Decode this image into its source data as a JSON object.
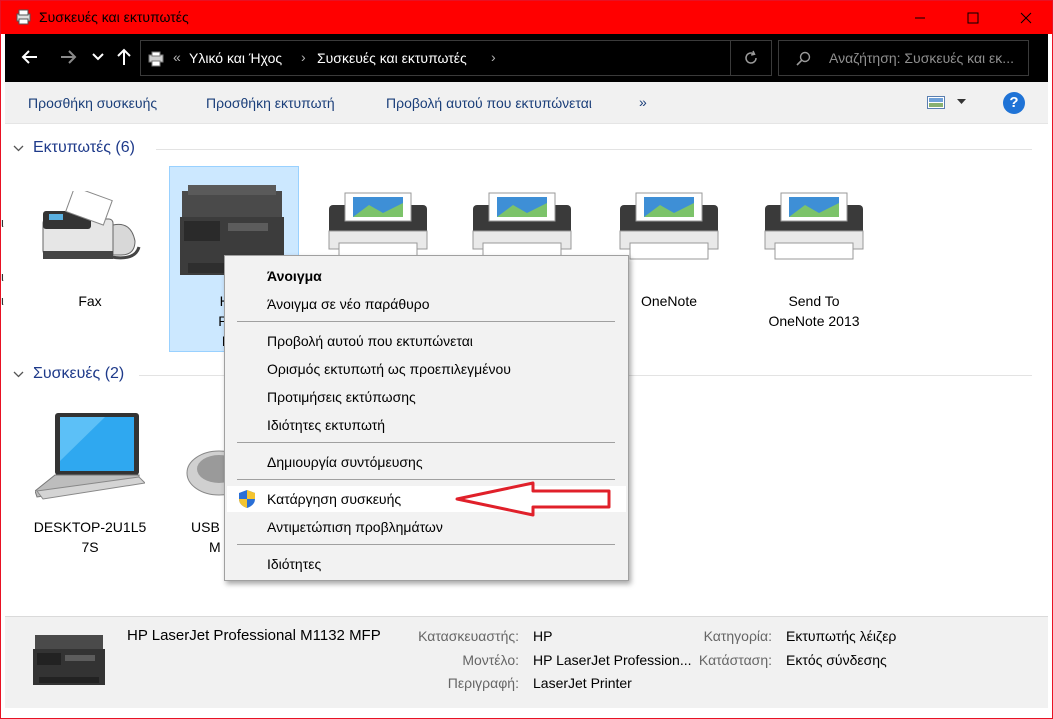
{
  "window": {
    "title": "Συσκευές και εκτυπωτές",
    "accent_color": "#ff0000"
  },
  "address_bar": {
    "overflow": "«",
    "breadcrumbs": [
      "Υλικό και Ήχος",
      "Συσκευές και εκτυπωτές"
    ],
    "search_placeholder": "Αναζήτηση: Συσκευές και εκ..."
  },
  "command_bar": {
    "items": [
      "Προσθήκη συσκευής",
      "Προσθήκη εκτυπωτή",
      "Προβολή αυτού που εκτυπώνεται"
    ],
    "more": "»",
    "help": "?"
  },
  "printers": {
    "header": "Εκτυπωτές (6)",
    "items": [
      {
        "label": "Fax",
        "icon": "fax-icon"
      },
      {
        "label": "HP L... Prof... M11...",
        "icon": "mfp-printer-icon"
      },
      {
        "label": "",
        "icon": "printer-icon"
      },
      {
        "label": "",
        "icon": "printer-icon"
      },
      {
        "label": "OneNote",
        "icon": "printer-icon"
      },
      {
        "label": "Send To OneNote 2013",
        "icon": "printer-icon"
      }
    ],
    "selected_label_lines": [
      "HP L",
      "Profe",
      "M11"
    ],
    "send_to_lines": [
      "Send To",
      "OneNote 2013"
    ]
  },
  "devices": {
    "header": "Συσκευές (2)",
    "items": [
      {
        "label_lines": [
          "DESKTOP-2U1L5",
          "7S"
        ],
        "icon": "laptop-icon"
      },
      {
        "label_lines": [
          "USB",
          "M"
        ],
        "icon": "mouse-icon"
      }
    ]
  },
  "context_menu": {
    "items": [
      "Άνοιγμα",
      "Άνοιγμα σε νέο παράθυρο",
      "Προβολή αυτού που εκτυπώνεται",
      "Ορισμός εκτυπωτή ως προεπιλεγμένου",
      "Προτιμήσεις εκτύπωσης",
      "Ιδιότητες εκτυπωτή",
      "Δημιουργία συντόμευσης",
      "Κατάργηση συσκευής",
      "Αντιμετώπιση προβλημάτων",
      "Ιδιότητες"
    ],
    "highlighted_index": 7,
    "highlight_icon": "uac-shield-icon"
  },
  "details": {
    "name": "HP LaserJet Professional M1132 MFP",
    "fields": {
      "manufacturer_label": "Κατασκευαστής:",
      "manufacturer": "HP",
      "model_label": "Μοντέλο:",
      "model": "HP LaserJet Profession...",
      "description_label": "Περιγραφή:",
      "description": "LaserJet Printer",
      "category_label": "Κατηγορία:",
      "category": "Εκτυπωτής λέιζερ",
      "status_label": "Κατάσταση:",
      "status": "Εκτός σύνδεσης"
    }
  }
}
